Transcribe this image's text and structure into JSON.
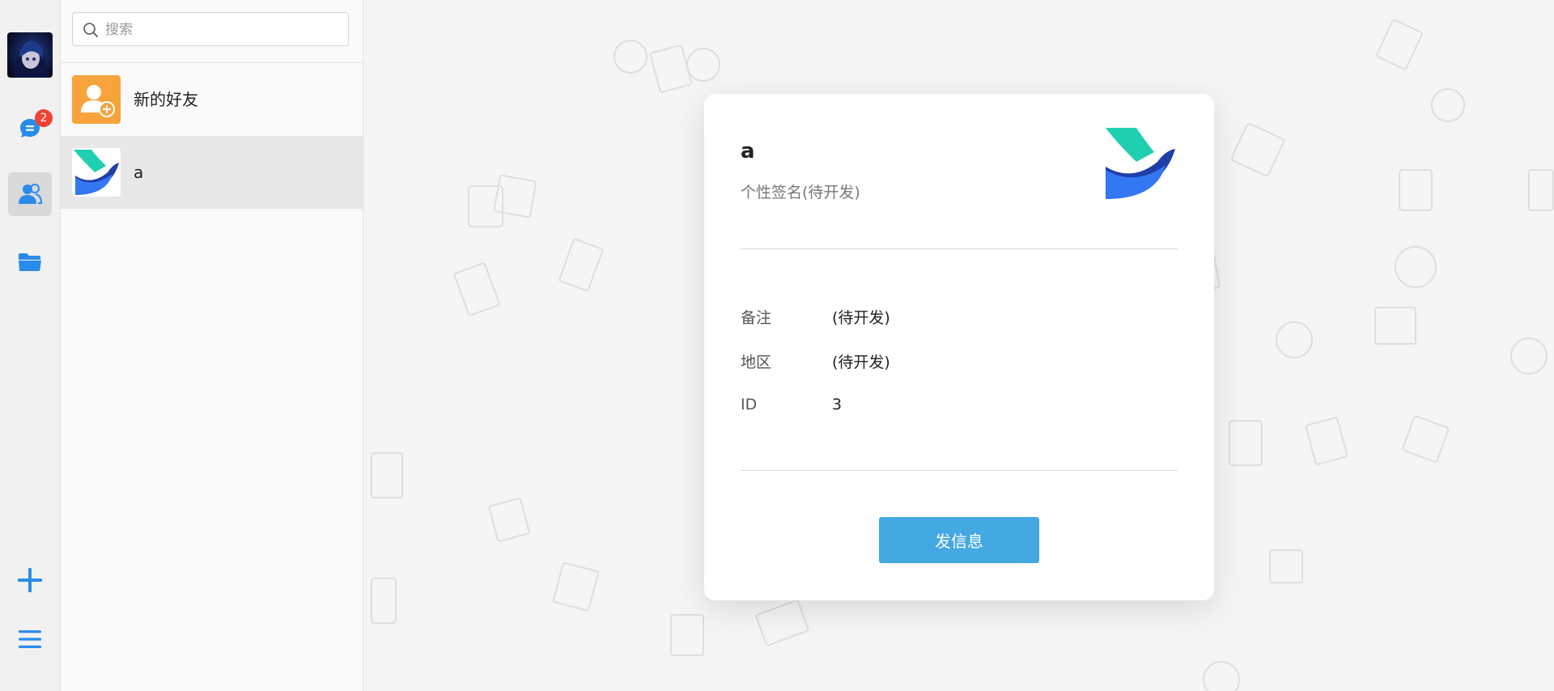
{
  "sidebar": {
    "chat_badge": "2",
    "colors": {
      "accent": "#2a8cea",
      "badge": "#f04134"
    }
  },
  "contacts": {
    "search_placeholder": "搜索",
    "items": [
      {
        "name": "新的好友",
        "icon": "add-friend-icon"
      },
      {
        "name": "a",
        "icon": "bird-logo"
      }
    ]
  },
  "profile": {
    "name": "a",
    "signature": "个性签名(待开发)",
    "fields": [
      {
        "key": "备注",
        "value": "(待开发)"
      },
      {
        "key": "地区",
        "value": "(待开发)"
      },
      {
        "key": "ID",
        "value": "3"
      }
    ],
    "send_label": "发信息",
    "send_color": "#44a8e3"
  }
}
